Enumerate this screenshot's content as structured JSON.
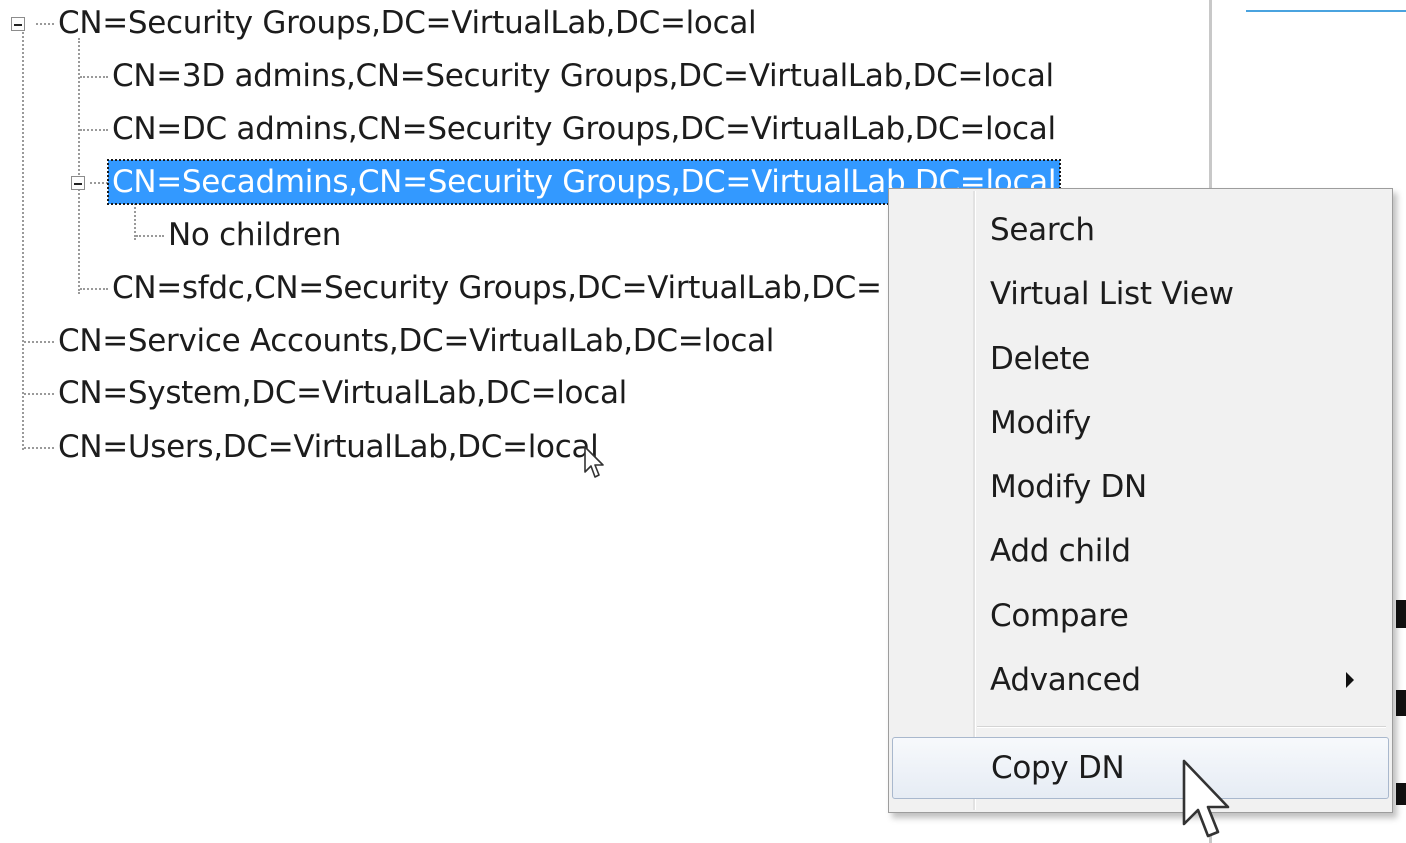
{
  "tree": {
    "nodes": [
      {
        "label": "CN=Security Groups,DC=VirtualLab,DC=local"
      },
      {
        "label": "CN=3D admins,CN=Security Groups,DC=VirtualLab,DC=local"
      },
      {
        "label": "CN=DC admins,CN=Security Groups,DC=VirtualLab,DC=local"
      },
      {
        "label": "CN=Secadmins,CN=Security Groups,DC=VirtualLab,DC=local"
      },
      {
        "label": "No children"
      },
      {
        "label": "CN=sfdc,CN=Security Groups,DC=VirtualLab,DC="
      },
      {
        "label": "CN=Service Accounts,DC=VirtualLab,DC=local"
      },
      {
        "label": "CN=System,DC=VirtualLab,DC=local"
      },
      {
        "label": "CN=Users,DC=VirtualLab,DC=local"
      }
    ]
  },
  "context_menu": {
    "items": [
      {
        "label": "Search"
      },
      {
        "label": "Virtual List View"
      },
      {
        "label": "Delete"
      },
      {
        "label": "Modify"
      },
      {
        "label": "Modify DN"
      },
      {
        "label": "Add child"
      },
      {
        "label": "Compare"
      },
      {
        "label": "Advanced",
        "has_submenu": true
      },
      {
        "label": "Copy DN",
        "hovered": true
      }
    ]
  },
  "colors": {
    "selection": "#3399ff",
    "menu_background": "#f1f1f1",
    "hover_border": "#a9b8cd"
  }
}
